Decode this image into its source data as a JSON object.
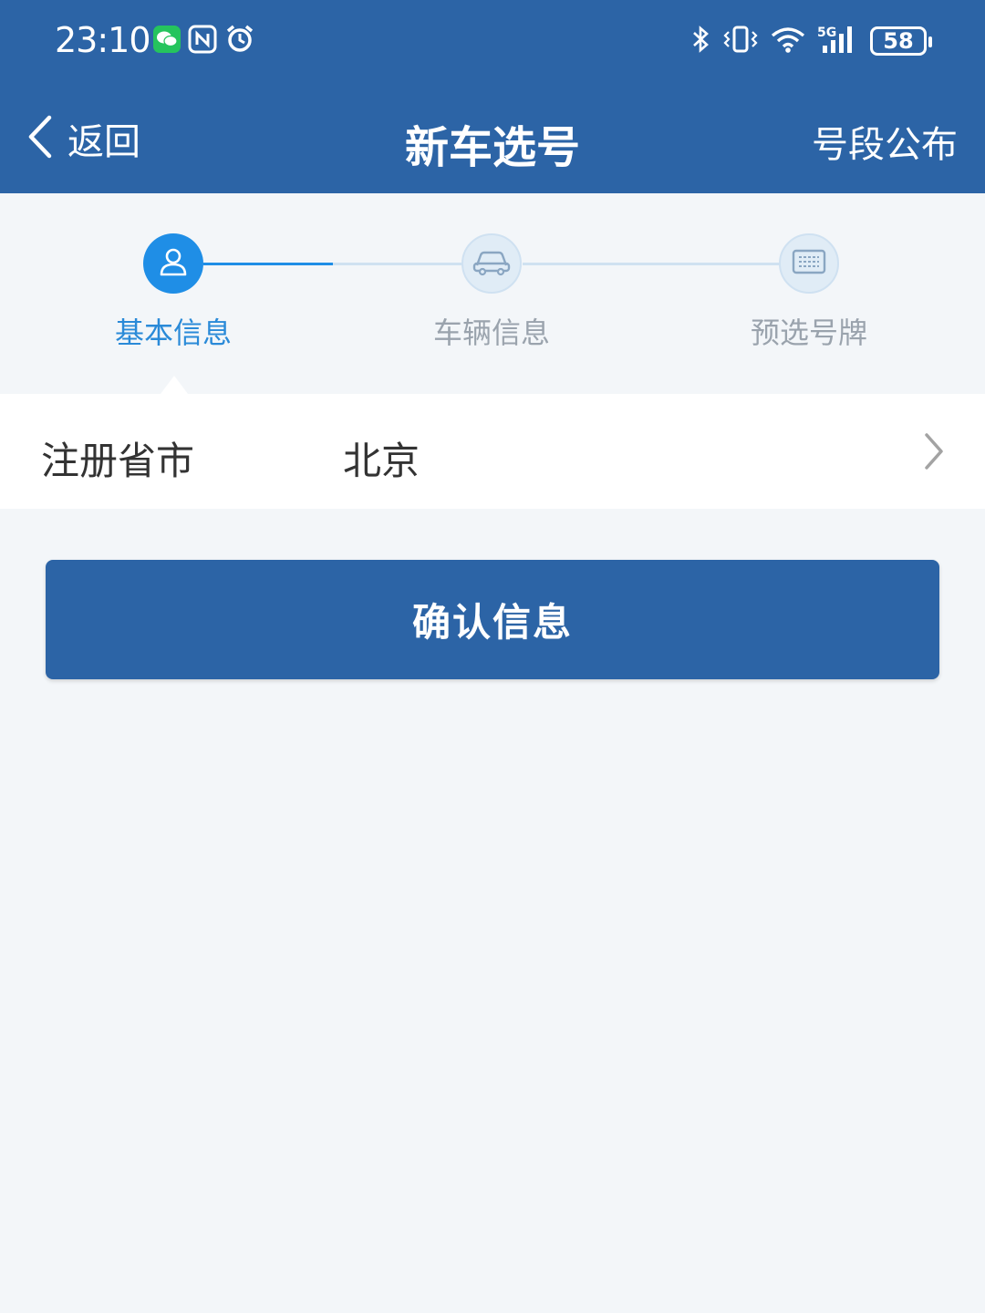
{
  "status_bar": {
    "time": "23:10",
    "left_icons": [
      "wechat-icon",
      "nfc-icon",
      "alarm-icon"
    ],
    "right_icons": [
      "bluetooth-icon",
      "vibrate-icon",
      "wifi-icon",
      "signal-5g-icon"
    ],
    "battery_level": "58"
  },
  "nav": {
    "back_label": "返回",
    "title": "新车选号",
    "right_label": "号段公布"
  },
  "steps": [
    {
      "label": "基本信息",
      "icon": "person-icon",
      "state": "active"
    },
    {
      "label": "车辆信息",
      "icon": "car-icon",
      "state": "inactive"
    },
    {
      "label": "预选号牌",
      "icon": "license-plate-icon",
      "state": "inactive"
    }
  ],
  "form": {
    "region_label": "注册省市",
    "region_value": "北京"
  },
  "confirm_button_label": "确认信息",
  "colors": {
    "header_blue": "#2c64a6",
    "step_active": "#1f8ee6",
    "step_inactive_text": "#9aa3ad",
    "background": "#f3f6f9"
  }
}
